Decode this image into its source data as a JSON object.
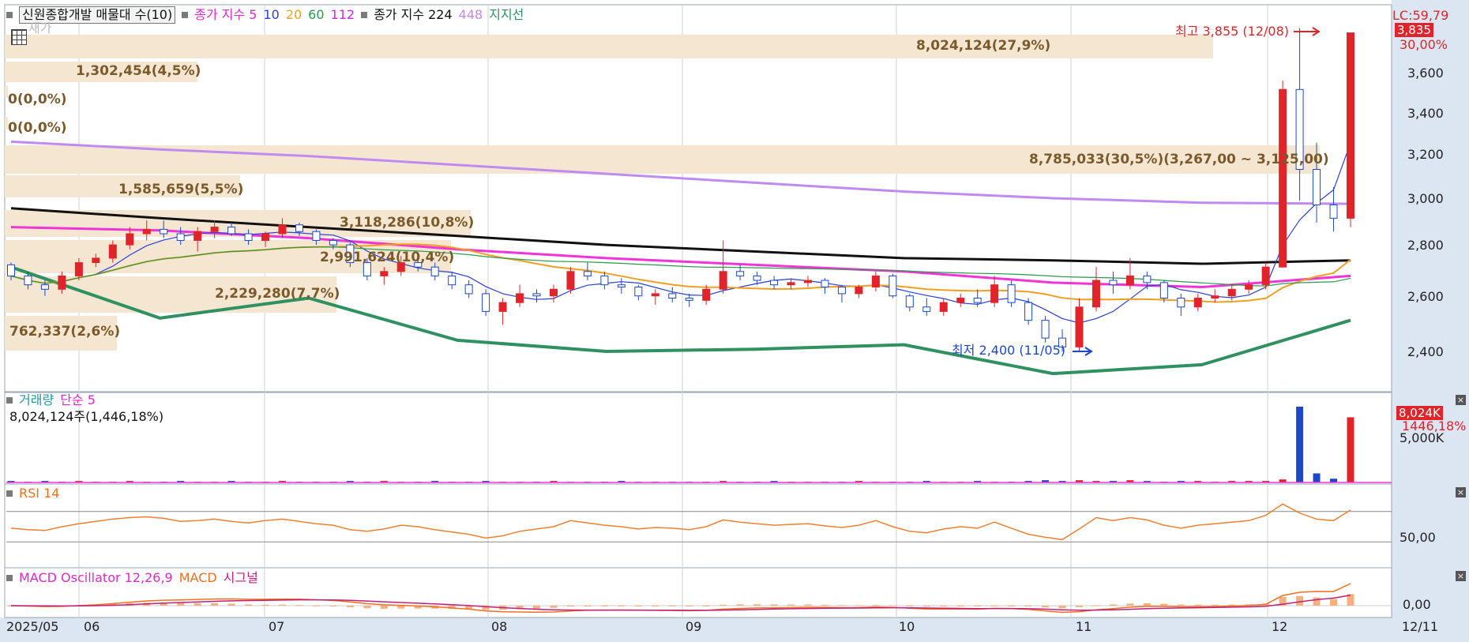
{
  "header": {
    "symbol_box": "신원종합개발 매물대 수(10)",
    "ma_legend_prefix": "종가 지수 5",
    "ma_10": "10",
    "ma_20": "20",
    "ma_60": "60",
    "ma_112": "112",
    "ma2_prefix": "종가 지수 224",
    "ma2_448": "448",
    "support_label": "지지선",
    "ghost_text": "새가"
  },
  "price_axis": {
    "lc_tag": "LC:59,79",
    "current_tag": "3,835",
    "pct_tag": "30,00%",
    "ticks": [
      "3,600",
      "3,400",
      "3,200",
      "3,000",
      "2,800",
      "2,600",
      "2,400"
    ]
  },
  "annotations": {
    "high": "최고 3,855 (12/08)",
    "low": "최저 2,400 (11/05)"
  },
  "volume_profile": [
    {
      "label": "8,024,124(27,9%)",
      "price": 3000,
      "pct": 27.9
    },
    {
      "label": "1,302,454(4,5%)",
      "price": 3000,
      "pct": 4.5
    },
    {
      "label": "0(0,0%)",
      "price": 3000,
      "pct": 0
    },
    {
      "label": "0(0,0%)",
      "price": 3000,
      "pct": 0
    },
    {
      "label": "8,785,033(30,5%)(3,267,00 ~ 3,125,00)",
      "price": 3195,
      "pct": 30.5
    },
    {
      "label": "1,585,659(5,5%)",
      "price": 3000,
      "pct": 5.5
    },
    {
      "label": "3,118,286(10,8%)",
      "price": 2920,
      "pct": 10.8
    },
    {
      "label": "2,991,624(10,4%)",
      "price": 2790,
      "pct": 10.4
    },
    {
      "label": "2,229,280(7,7%)",
      "price": 2650,
      "pct": 7.7
    },
    {
      "label": "762,337(2,6%)",
      "price": 2480,
      "pct": 2.6
    }
  ],
  "volume_panel": {
    "title": "거래량",
    "ma_label": "단순 5",
    "value_text": "8,024,124주(1,446,18%)",
    "tag": "8,024K",
    "pct_tag": "1446,18%",
    "tick": "5,000K"
  },
  "rsi_panel": {
    "title": "RSI 14",
    "tick": "50,00"
  },
  "macd_panel": {
    "title": "MACD Oscillator 12,26,9",
    "macd_label": "MACD",
    "signal_label": "시그널",
    "tick": "0,00"
  },
  "x_axis": {
    "start_label": "2025/05",
    "months": [
      "06",
      "07",
      "08",
      "09",
      "10",
      "11",
      "12"
    ],
    "end_label": "12/11"
  },
  "colors": {
    "up": "#e0242a",
    "down": "#1c48c8",
    "ma5": "#2a3fd8",
    "ma20": "#f0a020",
    "ma60": "#2a9a4a",
    "ma112": "#f034d8",
    "ma224": "#111111",
    "ma448": "#c08af0",
    "support": "#2f9060",
    "profile": "#f4e6d0",
    "axis_bg": "#dce5f2"
  },
  "chart_data": {
    "type": "candlestick",
    "title": "신원종합개발",
    "ylim": [
      2300,
      3900
    ],
    "ohlc": [
      [
        2790,
        2800,
        2720,
        2740
      ],
      [
        2740,
        2760,
        2680,
        2700
      ],
      [
        2700,
        2720,
        2650,
        2680
      ],
      [
        2680,
        2760,
        2660,
        2740
      ],
      [
        2740,
        2820,
        2720,
        2800
      ],
      [
        2800,
        2840,
        2780,
        2820
      ],
      [
        2820,
        2900,
        2800,
        2880
      ],
      [
        2880,
        2960,
        2860,
        2930
      ],
      [
        2930,
        2990,
        2900,
        2950
      ],
      [
        2950,
        2990,
        2910,
        2930
      ],
      [
        2930,
        2960,
        2880,
        2900
      ],
      [
        2900,
        2960,
        2850,
        2940
      ],
      [
        2940,
        2990,
        2910,
        2960
      ],
      [
        2960,
        2980,
        2920,
        2930
      ],
      [
        2930,
        2950,
        2880,
        2900
      ],
      [
        2900,
        2940,
        2870,
        2930
      ],
      [
        2930,
        3000,
        2910,
        2970
      ],
      [
        2970,
        2980,
        2920,
        2940
      ],
      [
        2940,
        2950,
        2880,
        2900
      ],
      [
        2900,
        2910,
        2860,
        2880
      ],
      [
        2880,
        2890,
        2780,
        2800
      ],
      [
        2800,
        2820,
        2720,
        2740
      ],
      [
        2740,
        2780,
        2700,
        2760
      ],
      [
        2760,
        2830,
        2740,
        2800
      ],
      [
        2800,
        2840,
        2760,
        2780
      ],
      [
        2780,
        2800,
        2720,
        2740
      ],
      [
        2740,
        2760,
        2680,
        2700
      ],
      [
        2700,
        2720,
        2640,
        2660
      ],
      [
        2660,
        2680,
        2560,
        2580
      ],
      [
        2580,
        2640,
        2520,
        2620
      ],
      [
        2620,
        2700,
        2600,
        2660
      ],
      [
        2660,
        2680,
        2620,
        2650
      ],
      [
        2650,
        2700,
        2620,
        2680
      ],
      [
        2680,
        2780,
        2660,
        2760
      ],
      [
        2760,
        2800,
        2720,
        2740
      ],
      [
        2740,
        2760,
        2680,
        2700
      ],
      [
        2700,
        2730,
        2660,
        2690
      ],
      [
        2690,
        2700,
        2630,
        2650
      ],
      [
        2650,
        2680,
        2610,
        2660
      ],
      [
        2660,
        2690,
        2620,
        2640
      ],
      [
        2640,
        2660,
        2600,
        2630
      ],
      [
        2630,
        2700,
        2610,
        2680
      ],
      [
        2680,
        2900,
        2660,
        2760
      ],
      [
        2760,
        2790,
        2720,
        2740
      ],
      [
        2740,
        2760,
        2700,
        2720
      ],
      [
        2720,
        2740,
        2680,
        2700
      ],
      [
        2700,
        2730,
        2680,
        2710
      ],
      [
        2710,
        2740,
        2690,
        2720
      ],
      [
        2720,
        2730,
        2660,
        2690
      ],
      [
        2690,
        2700,
        2620,
        2660
      ],
      [
        2660,
        2700,
        2640,
        2690
      ],
      [
        2690,
        2760,
        2670,
        2740
      ],
      [
        2740,
        2750,
        2640,
        2650
      ],
      [
        2650,
        2660,
        2580,
        2600
      ],
      [
        2600,
        2640,
        2560,
        2580
      ],
      [
        2580,
        2640,
        2560,
        2620
      ],
      [
        2620,
        2660,
        2600,
        2640
      ],
      [
        2640,
        2680,
        2600,
        2620
      ],
      [
        2620,
        2740,
        2600,
        2700
      ],
      [
        2700,
        2720,
        2600,
        2620
      ],
      [
        2620,
        2640,
        2520,
        2540
      ],
      [
        2540,
        2560,
        2440,
        2460
      ],
      [
        2460,
        2500,
        2400,
        2420
      ],
      [
        2420,
        2640,
        2400,
        2600
      ],
      [
        2600,
        2780,
        2580,
        2720
      ],
      [
        2720,
        2760,
        2660,
        2700
      ],
      [
        2700,
        2820,
        2680,
        2740
      ],
      [
        2740,
        2760,
        2680,
        2710
      ],
      [
        2710,
        2720,
        2620,
        2640
      ],
      [
        2640,
        2660,
        2560,
        2600
      ],
      [
        2600,
        2660,
        2580,
        2640
      ],
      [
        2640,
        2680,
        2620,
        2650
      ],
      [
        2650,
        2700,
        2630,
        2680
      ],
      [
        2680,
        2720,
        2660,
        2700
      ],
      [
        2700,
        2800,
        2680,
        2780
      ],
      [
        2780,
        3620,
        2780,
        3580
      ],
      [
        3580,
        3855,
        3080,
        3220
      ],
      [
        3220,
        3340,
        2980,
        3060
      ],
      [
        3060,
        3140,
        2940,
        3000
      ],
      [
        3000,
        3835,
        2960,
        3835
      ]
    ],
    "volume_bars": [
      0.02,
      0.01,
      0.02,
      0.01,
      0.02,
      0.01,
      0.01,
      0.02,
      0.01,
      0.01,
      0.02,
      0.01,
      0.01,
      0.02,
      0.01,
      0.01,
      0.02,
      0.01,
      0.01,
      0.01,
      0.02,
      0.01,
      0.02,
      0.01,
      0.01,
      0.02,
      0.01,
      0.01,
      0.02,
      0.01,
      0.01,
      0.01,
      0.02,
      0.01,
      0.01,
      0.01,
      0.02,
      0.01,
      0.01,
      0.01,
      0.01,
      0.01,
      0.02,
      0.01,
      0.01,
      0.02,
      0.01,
      0.01,
      0.01,
      0.01,
      0.02,
      0.01,
      0.01,
      0.01,
      0.02,
      0.01,
      0.01,
      0.02,
      0.01,
      0.01,
      0.02,
      0.03,
      0.02,
      0.03,
      0.02,
      0.02,
      0.03,
      0.02,
      0.01,
      0.02,
      0.02,
      0.01,
      0.02,
      0.02,
      0.02,
      0.04,
      1.0,
      0.12,
      0.05,
      0.86
    ],
    "rsi": [
      48,
      46,
      45,
      50,
      54,
      57,
      60,
      62,
      63,
      61,
      57,
      58,
      60,
      57,
      55,
      58,
      60,
      57,
      54,
      52,
      46,
      44,
      47,
      52,
      50,
      46,
      43,
      40,
      35,
      38,
      44,
      47,
      50,
      58,
      55,
      52,
      50,
      47,
      49,
      48,
      46,
      50,
      59,
      56,
      54,
      52,
      53,
      54,
      51,
      49,
      52,
      58,
      50,
      44,
      42,
      47,
      50,
      48,
      56,
      48,
      40,
      36,
      33,
      47,
      62,
      58,
      62,
      59,
      52,
      48,
      52,
      54,
      56,
      58,
      65,
      80,
      68,
      60,
      58,
      72
    ],
    "ma_lines": {
      "ma224": [
        3045,
        3000,
        2960,
        2920,
        2880,
        2850,
        2820,
        2810,
        2795,
        2810
      ],
      "ma448": [
        3345,
        3310,
        3280,
        3240,
        3200,
        3160,
        3120,
        3090,
        3070,
        3065
      ],
      "ma112": [
        2960,
        2945,
        2910,
        2860,
        2820,
        2790,
        2760,
        2710,
        2690,
        2740
      ],
      "support": [
        2780,
        2550,
        2640,
        2450,
        2400,
        2410,
        2430,
        2300,
        2340,
        2540
      ]
    }
  }
}
